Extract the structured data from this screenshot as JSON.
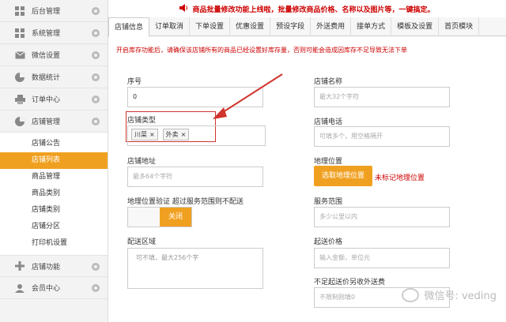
{
  "banner": {
    "text": "商品批量修改功能上线啦，批量修改商品价格、名称以及图片等，一键搞定。"
  },
  "sidebar": {
    "top_items": [
      {
        "label": "后台管理"
      },
      {
        "label": "系统管理"
      },
      {
        "label": "微信设置"
      },
      {
        "label": "数据统计"
      },
      {
        "label": "订单中心"
      },
      {
        "label": "店铺管理"
      }
    ],
    "sub_items": [
      {
        "label": "店铺公告"
      },
      {
        "label": "店铺列表"
      },
      {
        "label": "商品管理"
      },
      {
        "label": "商品类别"
      },
      {
        "label": "店铺类别"
      },
      {
        "label": "店铺分区"
      },
      {
        "label": "打印机设置"
      }
    ],
    "bottom_items": [
      {
        "label": "店铺功能"
      },
      {
        "label": "会员中心"
      }
    ]
  },
  "tabs": [
    {
      "label": "店铺信息"
    },
    {
      "label": "订单取消"
    },
    {
      "label": "下单设置"
    },
    {
      "label": "优惠设置"
    },
    {
      "label": "预设字段"
    },
    {
      "label": "外送费用"
    },
    {
      "label": "接单方式"
    },
    {
      "label": "模板及设置"
    },
    {
      "label": "首页模块"
    }
  ],
  "notice": "开启库存功能后，请确保该店铺所有的商品已经设置好库存量，否则可能会造成因库存不足导致无法下单",
  "form": {
    "serial_label": "序号",
    "serial_value": "0",
    "shop_name_label": "店铺名称",
    "shop_name_placeholder": "最大32个字符",
    "shop_type_label": "店铺类型",
    "shop_type_tags": [
      "川菜",
      "外卖"
    ],
    "tag_remove": "×",
    "shop_phone_label": "店铺电话",
    "shop_phone_placeholder": "可填多个，用空格隔开",
    "address_label": "店铺地址",
    "address_placeholder": "最多64个字符",
    "location_label": "地理位置",
    "location_button": "选取地理位置",
    "location_status": "未标记地理位置",
    "geo_verify_label": "地理位置验证 超过服务范围则不配送",
    "toggle_label": "关闭",
    "service_range_label": "服务范围",
    "service_range_placeholder": "多少公里以内",
    "delivery_area_label": "配送区域",
    "delivery_area_placeholder": "可不填，最大256个字",
    "min_price_label": "起送价格",
    "min_price_placeholder": "输入金额，单位元",
    "extra_fee_label": "不足起送价另收外送费",
    "extra_fee_placeholder": "不限制则填0"
  },
  "watermark": "微信号: veding",
  "colors": {
    "accent": "#f0a020",
    "alert": "#cc0000"
  }
}
